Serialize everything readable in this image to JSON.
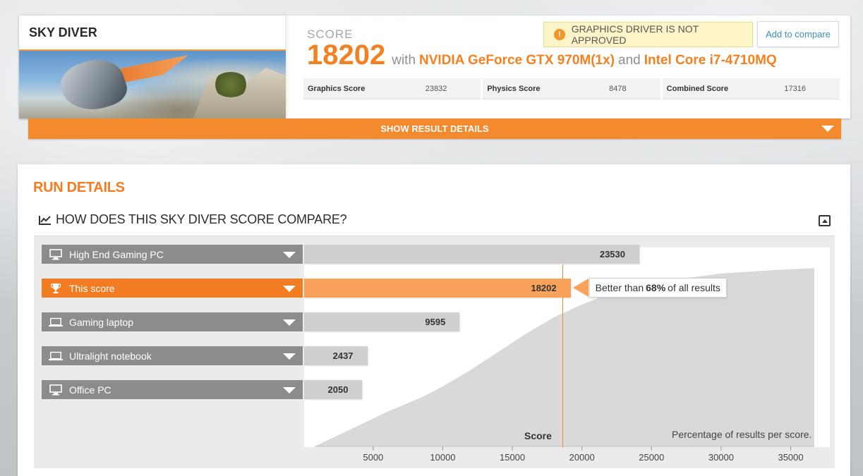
{
  "benchmark": {
    "title": "SKY DIVER"
  },
  "score": {
    "label": "SCORE",
    "value": "18202",
    "with_text": "with",
    "gpu": "NVIDIA GeForce GTX 970M(1x)",
    "and_text": "and",
    "cpu": "Intel Core i7-4710MQ"
  },
  "warning": {
    "icon": "exclamation-circle-icon",
    "text": "GRAPHICS DRIVER IS NOT APPROVED"
  },
  "compare_button": "Add to compare",
  "subscores": [
    {
      "name": "Graphics Score",
      "value": "23832"
    },
    {
      "name": "Physics Score",
      "value": "8478"
    },
    {
      "name": "Combined Score",
      "value": "17316"
    }
  ],
  "details_bar": {
    "label": "SHOW RESULT DETAILS"
  },
  "run_details": {
    "title": "RUN DETAILS",
    "compare_title": "HOW DOES THIS SKY DIVER SCORE COMPARE?"
  },
  "comparison_rows": [
    {
      "label": "High End Gaming PC",
      "value": "23530",
      "icon": "desktop-icon",
      "active": false
    },
    {
      "label": "This score",
      "value": "18202",
      "icon": "trophy-icon",
      "active": true
    },
    {
      "label": "Gaming laptop",
      "value": "9595",
      "icon": "laptop-icon",
      "active": false
    },
    {
      "label": "Ultralight notebook",
      "value": "2437",
      "icon": "laptop-icon",
      "active": false
    },
    {
      "label": "Office PC",
      "value": "2050",
      "icon": "desktop-icon",
      "active": false
    }
  ],
  "tooltip": {
    "prefix": "Better than",
    "percent": "68%",
    "suffix": "of all results"
  },
  "chart_data": {
    "type": "area",
    "xlabel": "Score",
    "ylabel": "Percentage of results per score.",
    "x_ticks": [
      5000,
      10000,
      15000,
      20000,
      25000,
      30000,
      35000
    ],
    "xlim": [
      800,
      37000
    ],
    "x": [
      800,
      3000,
      6000,
      8500,
      10000,
      12000,
      14000,
      16000,
      18000,
      20000,
      22000,
      24000,
      26000,
      28000,
      30000,
      32000,
      34000,
      36700
    ],
    "y": [
      0.0,
      0.08,
      0.19,
      0.27,
      0.33,
      0.42,
      0.52,
      0.62,
      0.71,
      0.78,
      0.84,
      0.88,
      0.91,
      0.93,
      0.95,
      0.96,
      0.97,
      0.98
    ],
    "ylim": [
      0,
      1
    ],
    "marker_value": 18600,
    "accent_color": "#f27c22",
    "fill_color": "#d9d9d9"
  }
}
